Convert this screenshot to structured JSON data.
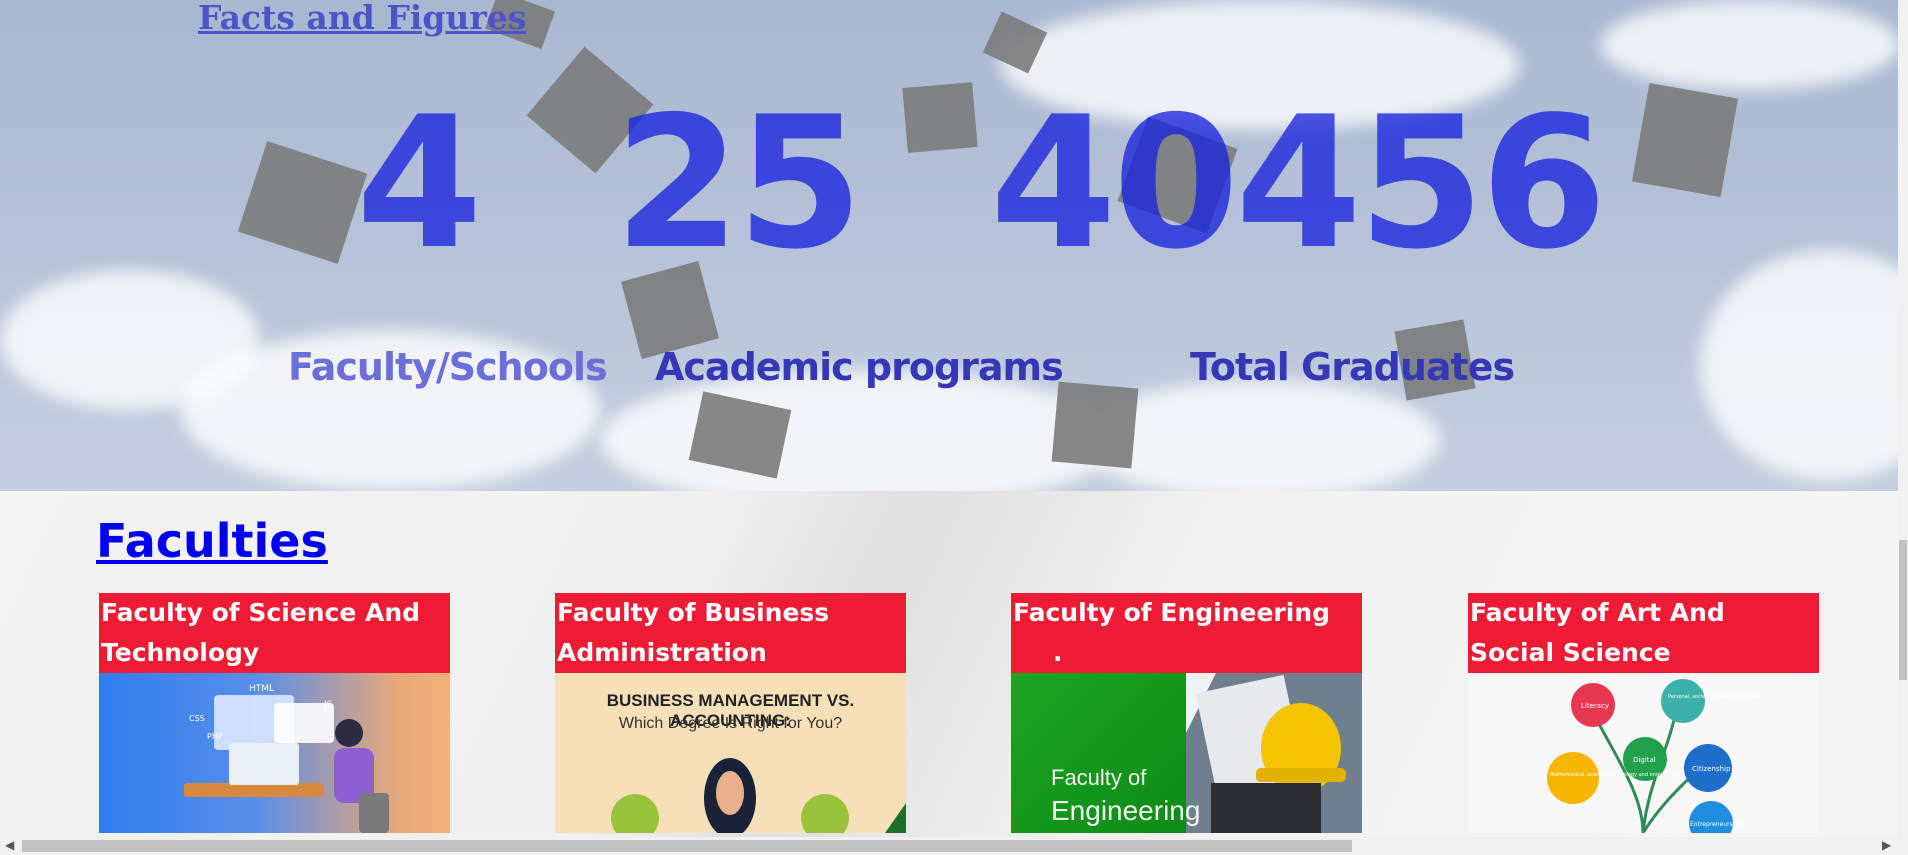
{
  "facts": {
    "title": "Facts and Figures",
    "stats": [
      {
        "number": "4",
        "label": "Faculty/Schools"
      },
      {
        "number": "25",
        "label": "Academic programs"
      },
      {
        "number": "40456",
        "label": "Total Graduates"
      }
    ]
  },
  "faculties": {
    "title": "Faculties",
    "cards": [
      {
        "title": "Faculty of Science And Technology",
        "image_caption": "",
        "image_tags": [
          "HTML",
          "JS",
          "CSS",
          "PHP"
        ]
      },
      {
        "title": "Faculty of Business Administration",
        "image_caption": "BUSINESS MANAGEMENT VS. ACCOUNTING:",
        "image_subcaption": "Which Degree Is Right for You?"
      },
      {
        "title": "Faculty of Engineering",
        "title_extra": ".",
        "image_caption": "Faculty of",
        "image_subcaption": "Engineering"
      },
      {
        "title": "Faculty of Art And Social Science",
        "image_bubbles": [
          "Literacy",
          "Personal, social and learning to learn",
          "Digital",
          "Citizenship",
          "Mathematical, science, technology and engineering",
          "Entrepreneurship"
        ]
      }
    ]
  },
  "colors": {
    "accent_red": "#ed1b34",
    "stat_blue": "#1824dc",
    "link_blue": "#0000ee"
  }
}
